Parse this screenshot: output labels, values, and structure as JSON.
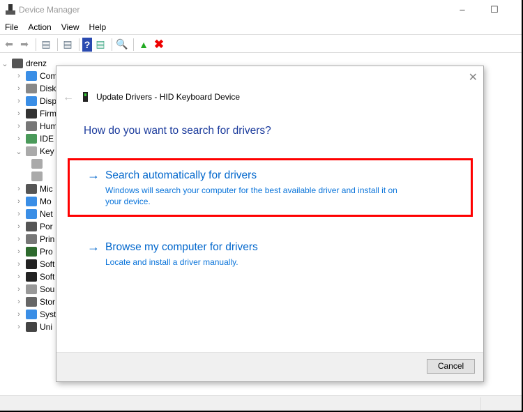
{
  "window": {
    "title": "Device Manager",
    "minimize_icon": "minimize-icon",
    "maximize_icon": "maximize-icon"
  },
  "menu": [
    "File",
    "Action",
    "View",
    "Help"
  ],
  "toolbar": [
    "back",
    "forward",
    "show-hide-console-tree",
    "properties",
    "help",
    "action-pane",
    "scan-hardware-changes",
    "update-driver",
    "uninstall-device"
  ],
  "tree": {
    "root": "drenz",
    "items": [
      {
        "label": "Com",
        "color": "#3a8ee6"
      },
      {
        "label": "Disk",
        "color": "#888"
      },
      {
        "label": "Disp",
        "color": "#3a8ee6"
      },
      {
        "label": "Firm",
        "color": "#333"
      },
      {
        "label": "Hum",
        "color": "#777"
      },
      {
        "label": "IDE",
        "color": "#4a9a5a"
      },
      {
        "label": "Key",
        "color": "#aaa",
        "expanded": true
      },
      {
        "label": "",
        "color": "#aaa",
        "child": true
      },
      {
        "label": "",
        "color": "#aaa",
        "child": true
      },
      {
        "label": "Mic",
        "color": "#555"
      },
      {
        "label": "Mo",
        "color": "#3a8ee6"
      },
      {
        "label": "Net",
        "color": "#3a8ee6"
      },
      {
        "label": "Por",
        "color": "#555"
      },
      {
        "label": "Prin",
        "color": "#777"
      },
      {
        "label": "Pro",
        "color": "#2d6a2d"
      },
      {
        "label": "Soft",
        "color": "#222"
      },
      {
        "label": "Soft",
        "color": "#222"
      },
      {
        "label": "Sou",
        "color": "#999"
      },
      {
        "label": "Stor",
        "color": "#666"
      },
      {
        "label": "Syst",
        "color": "#3a8ee6"
      },
      {
        "label": "Uni",
        "color": "#444"
      }
    ]
  },
  "dialog": {
    "title": "Update Drivers - HID Keyboard Device",
    "question": "How do you want to search for drivers?",
    "options": [
      {
        "title": "Search automatically for drivers",
        "desc": "Windows will search your computer for the best available driver and install it on your device.",
        "highlighted": true
      },
      {
        "title": "Browse my computer for drivers",
        "desc": "Locate and install a driver manually.",
        "highlighted": false
      }
    ],
    "cancel": "Cancel",
    "highlight_color": "#ff0000",
    "link_color": "#0066cc"
  }
}
